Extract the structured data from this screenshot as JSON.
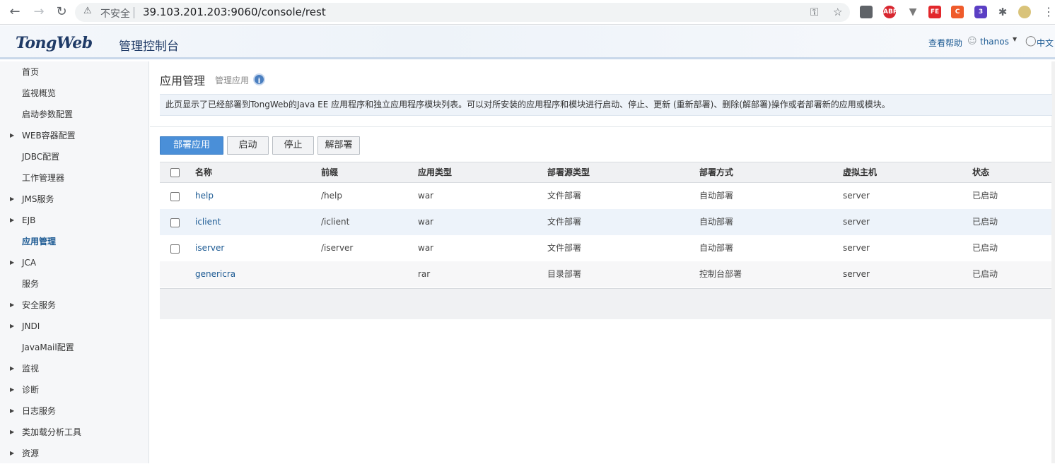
{
  "browser": {
    "insecure_label": "不安全",
    "url": "39.103.201.203:9060/console/rest",
    "extensions": [
      {
        "name": "abp",
        "label": "ABP",
        "color": "#d8262f"
      },
      {
        "name": "fe",
        "label": "FE",
        "color": "#e2282c"
      },
      {
        "name": "c",
        "label": "C",
        "color": "#ef5b2b"
      },
      {
        "name": "badge",
        "label": "3",
        "color": "#5b3fc4"
      }
    ]
  },
  "header": {
    "logo_text": "TongWeb",
    "logo_subtitle": "管理控制台",
    "help_label": "查看帮助",
    "user_label": "thanos",
    "language_label": "中文"
  },
  "sidebar": {
    "items": [
      {
        "label": "首页",
        "expandable": false,
        "active": false
      },
      {
        "label": "监视概览",
        "expandable": false,
        "active": false
      },
      {
        "label": "启动参数配置",
        "expandable": false,
        "active": false
      },
      {
        "label": "WEB容器配置",
        "expandable": true,
        "active": false
      },
      {
        "label": "JDBC配置",
        "expandable": false,
        "active": false
      },
      {
        "label": "工作管理器",
        "expandable": false,
        "active": false
      },
      {
        "label": "JMS服务",
        "expandable": true,
        "active": false
      },
      {
        "label": "EJB",
        "expandable": true,
        "active": false
      },
      {
        "label": "应用管理",
        "expandable": false,
        "active": true
      },
      {
        "label": "JCA",
        "expandable": true,
        "active": false
      },
      {
        "label": "服务",
        "expandable": false,
        "active": false
      },
      {
        "label": "安全服务",
        "expandable": true,
        "active": false
      },
      {
        "label": "JNDI",
        "expandable": true,
        "active": false
      },
      {
        "label": "JavaMail配置",
        "expandable": false,
        "active": false
      },
      {
        "label": "监视",
        "expandable": true,
        "active": false
      },
      {
        "label": "诊断",
        "expandable": true,
        "active": false
      },
      {
        "label": "日志服务",
        "expandable": true,
        "active": false
      },
      {
        "label": "类加载分析工具",
        "expandable": true,
        "active": false
      },
      {
        "label": "资源",
        "expandable": true,
        "active": false
      }
    ]
  },
  "main": {
    "title": "应用管理",
    "subtitle": "管理应用",
    "description": "此页显示了已经部署到TongWeb的Java EE 应用程序和独立应用程序模块列表。可以对所安装的应用程序和模块进行启动、停止、更新 (重新部署)、删除(解部署)操作或者部署新的应用或模块。",
    "buttons": {
      "deploy": "部署应用",
      "start": "启动",
      "stop": "停止",
      "undeploy": "解部署"
    },
    "table": {
      "headers": [
        "名称",
        "前缀",
        "应用类型",
        "部署源类型",
        "部署方式",
        "虚拟主机",
        "状态"
      ],
      "rows": [
        {
          "name": "help",
          "prefix": "/help",
          "type": "war",
          "source": "文件部署",
          "method": "自动部署",
          "host": "server",
          "status": "已启动",
          "selectable": true
        },
        {
          "name": "iclient",
          "prefix": "/iclient",
          "type": "war",
          "source": "文件部署",
          "method": "自动部署",
          "host": "server",
          "status": "已启动",
          "selectable": true
        },
        {
          "name": "iserver",
          "prefix": "/iserver",
          "type": "war",
          "source": "文件部署",
          "method": "自动部署",
          "host": "server",
          "status": "已启动",
          "selectable": true
        },
        {
          "name": "genericra",
          "prefix": "",
          "type": "rar",
          "source": "目录部署",
          "method": "控制台部署",
          "host": "server",
          "status": "已启动",
          "selectable": false
        }
      ]
    }
  }
}
